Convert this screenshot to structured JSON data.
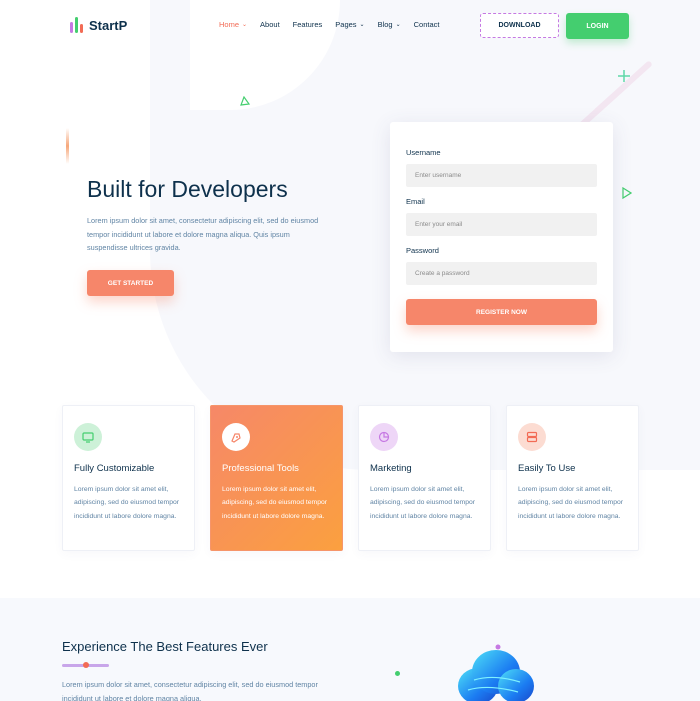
{
  "brand": {
    "name": "StartP",
    "bar_colors": [
      "#c679e3",
      "#44ce6f",
      "#f26b55"
    ]
  },
  "nav": {
    "items": [
      {
        "label": "Home",
        "dropdown": true,
        "active": true
      },
      {
        "label": "About",
        "dropdown": false,
        "active": false
      },
      {
        "label": "Features",
        "dropdown": false,
        "active": false
      },
      {
        "label": "Pages",
        "dropdown": true,
        "active": false
      },
      {
        "label": "Blog",
        "dropdown": true,
        "active": false
      },
      {
        "label": "Contact",
        "dropdown": false,
        "active": false
      }
    ],
    "download_label": "DOWNLOAD",
    "login_label": "LOGIN"
  },
  "hero": {
    "title": "Built for Developers",
    "text": "Lorem ipsum dolor sit amet, consectetur adipiscing elit, sed do eiusmod tempor incididunt ut labore et dolore magna aliqua. Quis ipsum suspendisse ultrices gravida.",
    "cta_label": "GET STARTED"
  },
  "register": {
    "username_label": "Username",
    "username_placeholder": "Enter username",
    "email_label": "Email",
    "email_placeholder": "Enter your email",
    "password_label": "Password",
    "password_placeholder": "Create a password",
    "submit_label": "REGISTER NOW"
  },
  "features": [
    {
      "title": "Fully Customizable",
      "text": "Lorem ipsum dolor sit amet elit, adipiscing, sed do eiusmod tempor incididunt ut labore dolore magna.",
      "icon": "monitor-icon",
      "icon_bg": "#cdf1d8",
      "icon_color": "#44ce6f",
      "highlight": false
    },
    {
      "title": "Professional Tools",
      "text": "Lorem ipsum dolor sit amet elit, adipiscing, sed do eiusmod tempor incididunt ut labore dolore magna.",
      "icon": "pen-tool-icon",
      "icon_bg": "#ffffff",
      "icon_color": "#f6866a",
      "highlight": true
    },
    {
      "title": "Marketing",
      "text": "Lorem ipsum dolor sit amet elit, adipiscing, sed do eiusmod tempor incididunt ut labore dolore magna.",
      "icon": "pie-chart-icon",
      "icon_bg": "#eed6f7",
      "icon_color": "#c679e3",
      "highlight": false
    },
    {
      "title": "Easily To Use",
      "text": "Lorem ipsum dolor sit amet elit, adipiscing, sed do eiusmod tempor incididunt ut labore dolore magna.",
      "icon": "server-icon",
      "icon_bg": "#fcdcd2",
      "icon_color": "#f26b55",
      "highlight": false
    }
  ],
  "bottom": {
    "title": "Experience The Best Features Ever",
    "text": "Lorem ipsum dolor sit amet, consectetur adipiscing elit, sed do eiusmod tempor incididunt ut labore et dolore magna aliqua."
  },
  "colors": {
    "accent": "#f26b55",
    "green": "#44ce6f",
    "purple": "#c679e3",
    "orange": "#f6866a",
    "heading": "#0e314c",
    "body": "#6084a4"
  }
}
